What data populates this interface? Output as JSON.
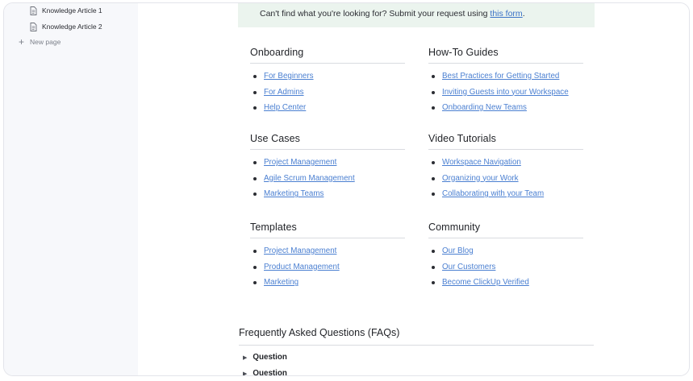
{
  "sidebar": {
    "items": [
      {
        "label": "Knowledge Article 1",
        "icon": "document-icon"
      },
      {
        "label": "Knowledge Article 2",
        "icon": "document-icon"
      }
    ],
    "new_page": {
      "label": "New page",
      "icon": "plus-icon"
    }
  },
  "banner": {
    "text": "Can't find what you're looking for? Submit your request using",
    "link": "this form",
    "end": "."
  },
  "sections": {
    "onboarding": {
      "title": "Onboarding",
      "links": [
        "For Beginners",
        "For Admins",
        "Help Center"
      ]
    },
    "howto": {
      "title": "How-To Guides",
      "links": [
        "Best Practices for Getting Started",
        "Inviting Guests into your Workspace",
        "Onboarding New Teams"
      ]
    },
    "usecases": {
      "title": "Use Cases",
      "links": [
        "Project Management",
        "Agile Scrum Management",
        "Marketing Teams"
      ]
    },
    "video": {
      "title": "Video Tutorials",
      "links": [
        "Workspace Navigation",
        "Organizing your Work",
        "Collaborating with your Team"
      ]
    },
    "templates": {
      "title": "Templates",
      "links": [
        "Project Management",
        "Product Management",
        "Marketing"
      ]
    },
    "community": {
      "title": "Community",
      "links": [
        "Our Blog",
        "Our Customers",
        "Become ClickUp Verified"
      ]
    }
  },
  "faq": {
    "title": "Frequently Asked Questions (FAQs)",
    "items": [
      "Question",
      "Question"
    ]
  },
  "colors": {
    "link": "#4a7fd1",
    "banner_bg": "#ebf4ee",
    "sidebar_bg": "#f7f8fb"
  }
}
